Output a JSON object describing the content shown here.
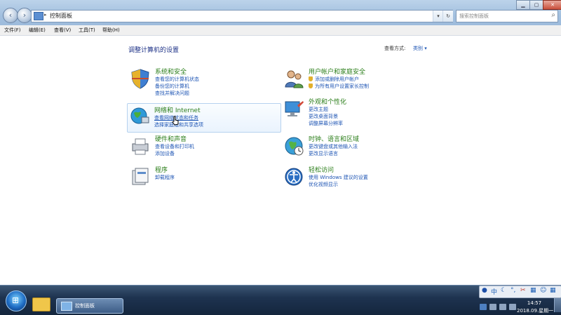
{
  "addressbar": {
    "path": "控制面板",
    "search_placeholder": "搜索控制面板"
  },
  "menu": [
    "文件(F)",
    "编辑(E)",
    "查看(V)",
    "工具(T)",
    "帮助(H)"
  ],
  "page": {
    "title": "调整计算机的设置",
    "view_by_label": "查看方式:",
    "view_by_value": "类别 ▾"
  },
  "categories": [
    {
      "title": "系统和安全",
      "links": [
        "查看您的计算机状态",
        "备份您的计算机",
        "查找并解决问题"
      ]
    },
    {
      "title": "网络和 Internet",
      "links": [
        "查看网络状态和任务",
        "选择家庭组和共享选项"
      ]
    },
    {
      "title": "硬件和声音",
      "links": [
        "查看设备和打印机",
        "添加设备"
      ]
    },
    {
      "title": "程序",
      "links": [
        "卸载程序"
      ]
    },
    {
      "title": "用户帐户和家庭安全",
      "links": [
        "添加或删除用户帐户",
        "为所有用户设置家长控制"
      ]
    },
    {
      "title": "外观和个性化",
      "links": [
        "更改主题",
        "更改桌面背景",
        "调整屏幕分辨率"
      ]
    },
    {
      "title": "时钟、语言和区域",
      "links": [
        "更改键盘或其他输入法",
        "更改显示语言"
      ]
    },
    {
      "title": "轻松访问",
      "links": [
        "使用 Windows 建议的设置",
        "优化视频显示"
      ]
    }
  ],
  "taskbar": {
    "task_label": "控制面板",
    "time": "14:57",
    "date": "2018.09.星期一"
  },
  "ime": {
    "lang": "中"
  }
}
